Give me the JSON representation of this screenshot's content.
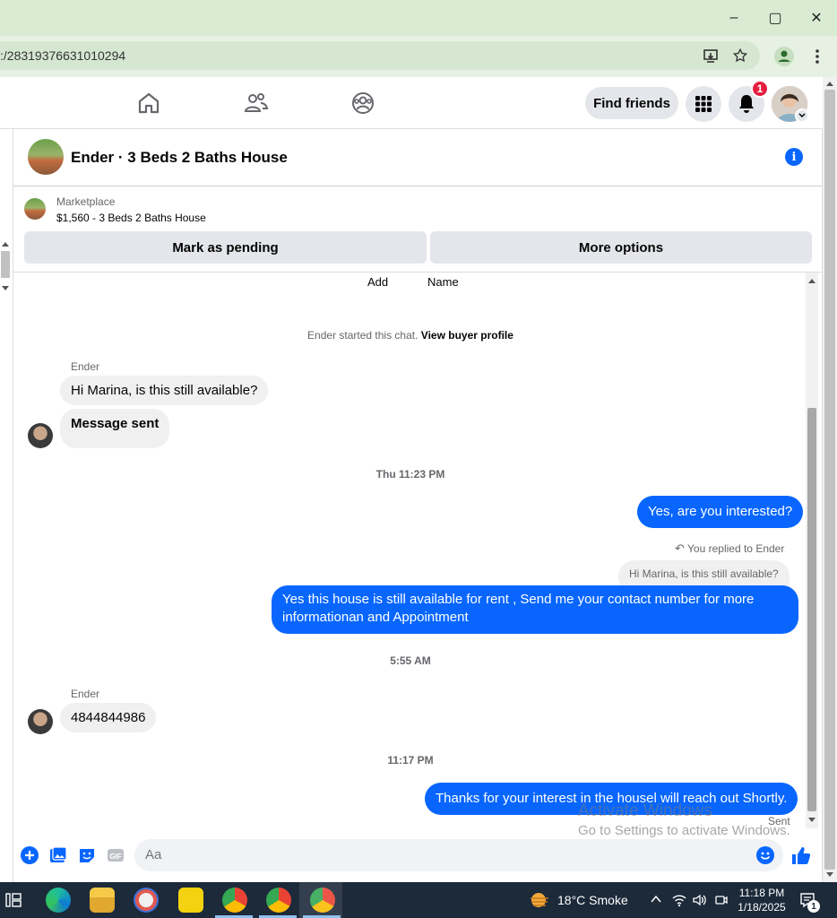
{
  "browser": {
    "url": ":/28319376631010294",
    "window_controls": [
      "–",
      "▢",
      "✕"
    ]
  },
  "header": {
    "find_friends": "Find friends",
    "notification_count": "1"
  },
  "chat": {
    "title": "Ender · 3 Beds 2 Baths House",
    "marketplace_label": "Marketplace",
    "marketplace_item": "$1,560 - 3 Beds 2 Baths House",
    "mark_pending": "Mark as pending",
    "more_options": "More options",
    "cut_labels": [
      "Add",
      "Name"
    ],
    "started_text": "Ender started this chat.",
    "view_profile": "View buyer profile",
    "messages": {
      "sender1": "Ender",
      "m1": "Hi Marina, is this still available?",
      "m2": "Message sent",
      "ts1": "Thu 11:23 PM",
      "m3": "Yes, are you interested?",
      "replied": "You replied to Ender",
      "quoted": "Hi Marina, is this still available?",
      "m4_line1": "Yes this house is still available for rent , Send me your contact number for more",
      "m4_line2": "informationan and Appointment",
      "ts2": "5:55 AM",
      "sender2": "Ender",
      "m5": "4844844986",
      "ts3": "11:17 PM",
      "m6": "Thanks for your interest in the housel will reach out Shortly.",
      "status": "Sent"
    },
    "composer_placeholder": "Aa"
  },
  "watermark": {
    "line1": "Activate Windows",
    "line2": "Go to Settings to activate Windows."
  },
  "taskbar": {
    "weather": "18°C  Smoke",
    "time": "11:18 PM",
    "date": "1/18/2025",
    "notif_count": "1"
  }
}
